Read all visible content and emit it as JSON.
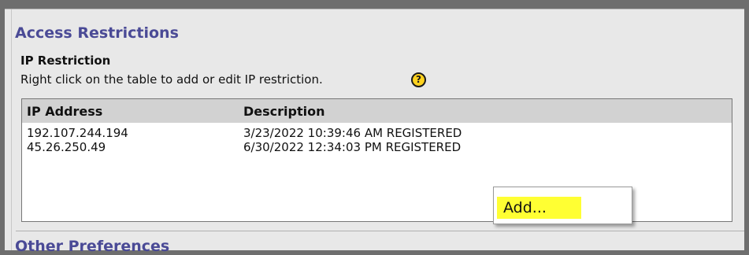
{
  "access_restrictions": {
    "title": "Access Restrictions",
    "ip_restriction": {
      "title": "IP Restriction",
      "help_text": "Right click on the table to add or edit IP restriction.",
      "help_icon": {
        "name": "help-icon",
        "glyph": "?"
      }
    },
    "table": {
      "columns": [
        "IP Address",
        "Description"
      ],
      "rows": [
        {
          "ip": "192.107.244.194",
          "description": "3/23/2022 10:39:46 AM REGISTERED"
        },
        {
          "ip": "45.26.250.49",
          "description": "6/30/2022 12:34:03 PM REGISTERED"
        }
      ]
    }
  },
  "other_preferences": {
    "title": "Other Preferences"
  },
  "context_menu": {
    "items": [
      {
        "label": "Add...",
        "highlight_color": "#ffff33"
      }
    ]
  },
  "colors": {
    "section_title": "#4a4a96",
    "panel_bg": "#e8e8e8",
    "header_bg": "#d2d2d2"
  }
}
